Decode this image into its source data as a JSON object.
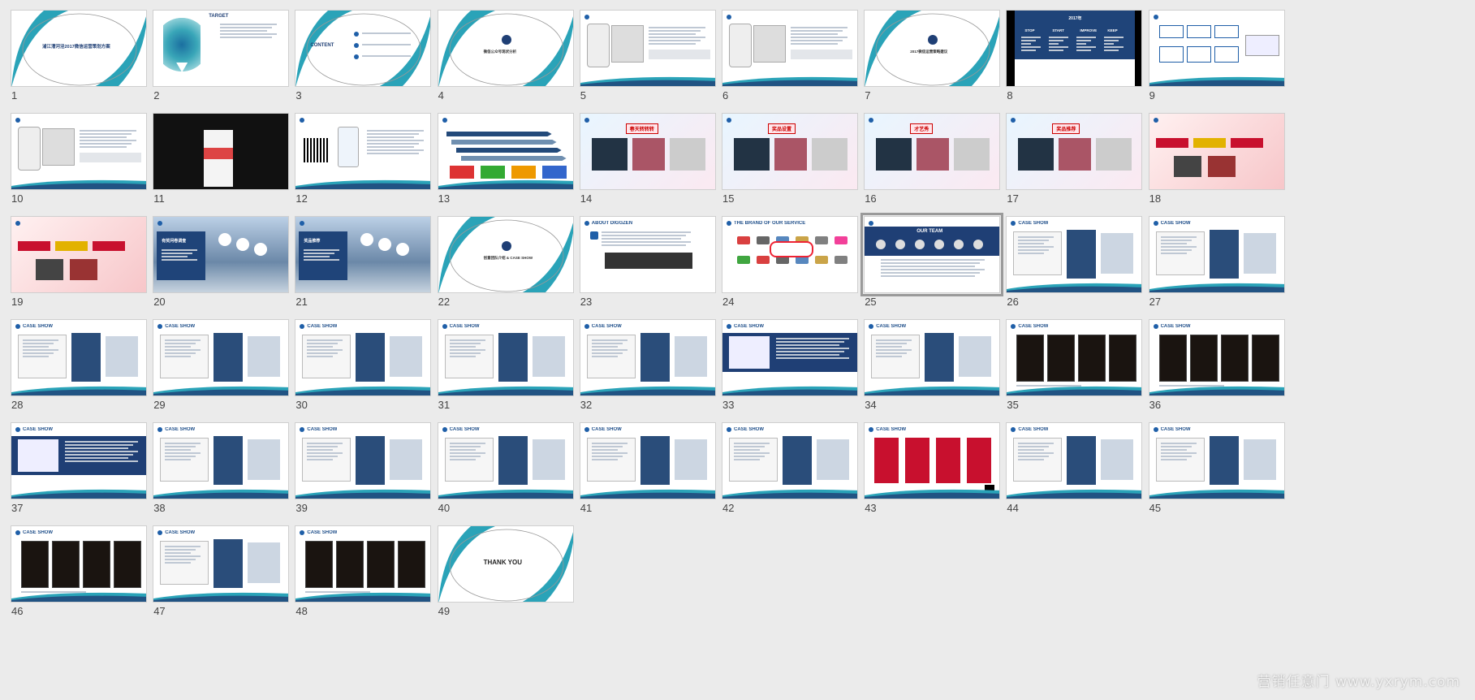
{
  "watermark": "营销任意门 www.yxrym.com",
  "slides": [
    {
      "num": "1",
      "kind": "cover",
      "title": "浦江漕河泾2017微信运营策划方案"
    },
    {
      "num": "2",
      "kind": "target",
      "title": "TARGET"
    },
    {
      "num": "3",
      "kind": "content",
      "title": "CONTENT"
    },
    {
      "num": "4",
      "kind": "section",
      "title": "微信公众号现状分析"
    },
    {
      "num": "5",
      "kind": "phones"
    },
    {
      "num": "6",
      "kind": "phones"
    },
    {
      "num": "7",
      "kind": "section",
      "title": "2017微信运营策略建议"
    },
    {
      "num": "8",
      "kind": "table",
      "title": "2017年",
      "cols": [
        "STOP",
        "START",
        "IMPROVE",
        "KEEP"
      ]
    },
    {
      "num": "9",
      "kind": "diagram"
    },
    {
      "num": "10",
      "kind": "phones"
    },
    {
      "num": "11",
      "kind": "dark"
    },
    {
      "num": "12",
      "kind": "qr"
    },
    {
      "num": "13",
      "kind": "timeline"
    },
    {
      "num": "14",
      "kind": "promo",
      "title": "春天转转转"
    },
    {
      "num": "15",
      "kind": "promo",
      "title": "奖品设置"
    },
    {
      "num": "16",
      "kind": "promo",
      "title": "才艺秀"
    },
    {
      "num": "17",
      "kind": "promo",
      "title": "奖品推荐"
    },
    {
      "num": "18",
      "kind": "red"
    },
    {
      "num": "19",
      "kind": "red"
    },
    {
      "num": "20",
      "kind": "city",
      "title": "有奖问卷调查"
    },
    {
      "num": "21",
      "kind": "city",
      "title": "奖品推荐"
    },
    {
      "num": "22",
      "kind": "section",
      "title": "创意团队介绍 & CASE SHOW"
    },
    {
      "num": "23",
      "kind": "about",
      "title": "ABOUT DIGGZEN"
    },
    {
      "num": "24",
      "kind": "logos",
      "title": "THE BRAND OF OUR SERVICE"
    },
    {
      "num": "25",
      "kind": "team",
      "title": "OUR TEAM"
    },
    {
      "num": "26",
      "kind": "case",
      "title": "CASE SHOW"
    },
    {
      "num": "27",
      "kind": "case",
      "title": "CASE SHOW"
    },
    {
      "num": "28",
      "kind": "case",
      "title": "CASE SHOW"
    },
    {
      "num": "29",
      "kind": "case",
      "title": "CASE SHOW"
    },
    {
      "num": "30",
      "kind": "case",
      "title": "CASE SHOW"
    },
    {
      "num": "31",
      "kind": "case",
      "title": "CASE SHOW"
    },
    {
      "num": "32",
      "kind": "case",
      "title": "CASE SHOW"
    },
    {
      "num": "33",
      "kind": "caseband",
      "title": "CASE SHOW"
    },
    {
      "num": "34",
      "kind": "case",
      "title": "CASE SHOW"
    },
    {
      "num": "35",
      "kind": "casedark",
      "title": "CASE SHOW"
    },
    {
      "num": "36",
      "kind": "casedark",
      "title": "CASE SHOW"
    },
    {
      "num": "37",
      "kind": "caseband",
      "title": "CASE SHOW"
    },
    {
      "num": "38",
      "kind": "case",
      "title": "CASE SHOW"
    },
    {
      "num": "39",
      "kind": "case",
      "title": "CASE SHOW"
    },
    {
      "num": "40",
      "kind": "case",
      "title": "CASE SHOW"
    },
    {
      "num": "41",
      "kind": "case",
      "title": "CASE SHOW"
    },
    {
      "num": "42",
      "kind": "case",
      "title": "CASE SHOW"
    },
    {
      "num": "43",
      "kind": "casered",
      "title": "CASE SHOW"
    },
    {
      "num": "44",
      "kind": "case",
      "title": "CASE SHOW"
    },
    {
      "num": "45",
      "kind": "case",
      "title": "CASE SHOW"
    },
    {
      "num": "46",
      "kind": "casedark",
      "title": "CASE SHOW"
    },
    {
      "num": "47",
      "kind": "case",
      "title": "CASE SHOW"
    },
    {
      "num": "48",
      "kind": "casedark",
      "title": "CASE SHOW"
    },
    {
      "num": "49",
      "kind": "thanks",
      "title": "THANK YOU"
    }
  ],
  "selected": "25",
  "colors": {
    "accent": "#1f5fa8",
    "teal": "#2aa3b8",
    "navy": "#1f3f75",
    "red": "#c8102e"
  }
}
